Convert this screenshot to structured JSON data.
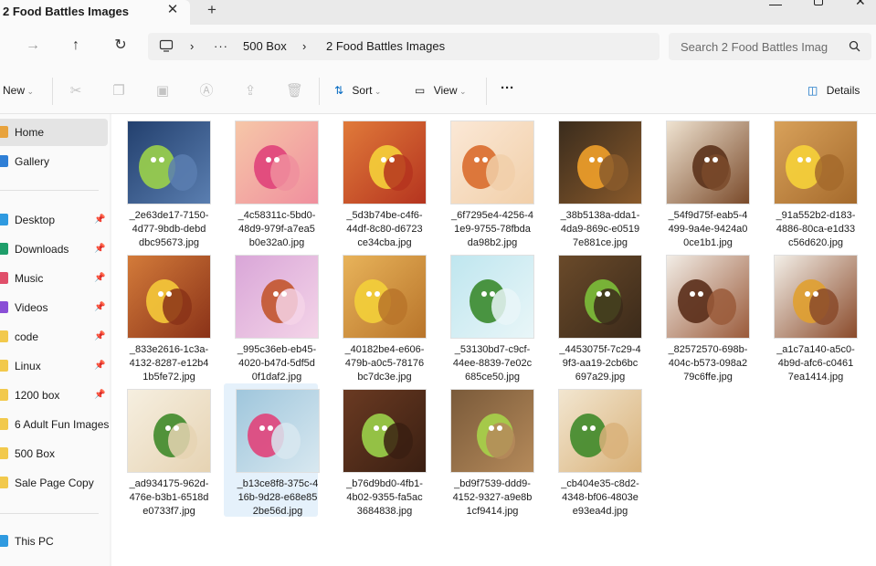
{
  "window": {
    "tab_title": "2 Food Battles Images"
  },
  "address": {
    "segments": [
      "500 Box",
      "2 Food Battles Images"
    ]
  },
  "search": {
    "placeholder": "Search 2 Food Battles Imag"
  },
  "toolbar": {
    "new_label": "New",
    "sort_label": "Sort",
    "view_label": "View",
    "details_label": "Details"
  },
  "sidebar": {
    "items": [
      {
        "label": "Home",
        "icon": "home-icon",
        "color": "#e8a33d"
      },
      {
        "label": "Gallery",
        "icon": "gallery-icon",
        "color": "#2f7fd6"
      },
      {
        "label": "Desktop",
        "icon": "desktop-icon",
        "color": "#2f9ae0"
      },
      {
        "label": "Downloads",
        "icon": "downloads-icon",
        "color": "#1f9e6a"
      },
      {
        "label": "Music",
        "icon": "music-icon",
        "color": "#e04f6a"
      },
      {
        "label": "Videos",
        "icon": "videos-icon",
        "color": "#8a4fd6"
      },
      {
        "label": "code",
        "icon": "folder-icon",
        "color": "#f2c94c"
      },
      {
        "label": "Linux",
        "icon": "folder-icon",
        "color": "#f2c94c"
      },
      {
        "label": "1200 box",
        "icon": "folder-icon",
        "color": "#f2c94c"
      },
      {
        "label": "6 Adult Fun Images",
        "icon": "folder-icon",
        "color": "#f2c94c"
      },
      {
        "label": "500 Box",
        "icon": "folder-icon",
        "color": "#f2c94c"
      },
      {
        "label": "Sale Page Copy",
        "icon": "folder-icon",
        "color": "#f2c94c"
      },
      {
        "label": "This PC",
        "icon": "pc-icon",
        "color": "#2f9ae0"
      }
    ]
  },
  "files": [
    {
      "name": "_2e63de17-7150-4d77-9bdb-debddbc95673.jpg",
      "l1": "_2e63de17-7150-",
      "l2": "4d77-9bdb-debd",
      "l3": "dbc95673.jpg",
      "bg1": "#23406e",
      "bg2": "#5a7eb0",
      "accent": "#9bd24a"
    },
    {
      "name": "_4c58311c-5bd0-48d9-979f-a7ea5b0e32a0.jpg",
      "l1": "_4c58311c-5bd0-",
      "l2": "48d9-979f-a7ea5",
      "l3": "b0e32a0.jpg",
      "bg1": "#f6c7a8",
      "bg2": "#f08f9e",
      "accent": "#e0437a"
    },
    {
      "name": "_5d3b74be-c4f6-44df-8c80-d6723ce34cba.jpg",
      "l1": "_5d3b74be-c4f6-",
      "l2": "44df-8c80-d6723",
      "l3": "ce34cba.jpg",
      "bg1": "#e07a3a",
      "bg2": "#b5341f",
      "accent": "#f5d03a"
    },
    {
      "name": "_6f7295e4-4256-41e9-9755-78fbdada98b2.jpg",
      "l1": "_6f7295e4-4256-4",
      "l2": "1e9-9755-78fbda",
      "l3": "da98b2.jpg",
      "bg1": "#fbe8d6",
      "bg2": "#f1cfa9",
      "accent": "#d96c2c"
    },
    {
      "name": "_38b5138a-dda1-4da9-869c-e05197e881ce.jpg",
      "l1": "_38b5138a-dda1-",
      "l2": "4da9-869c-e0519",
      "l3": "7e881ce.jpg",
      "bg1": "#3a2c1d",
      "bg2": "#8a5a2b",
      "accent": "#f0a02a"
    },
    {
      "name": "_54f9d75f-eab5-4499-9a4e-9424a00ce1b1.jpg",
      "l1": "_54f9d75f-eab5-4",
      "l2": "499-9a4e-9424a0",
      "l3": "0ce1b1.jpg",
      "bg1": "#efe3d1",
      "bg2": "#7a4a2a",
      "accent": "#5b321b"
    },
    {
      "name": "_91a552b2-d183-4886-80ca-e1d33c56d620.jpg",
      "l1": "_91a552b2-d183-",
      "l2": "4886-80ca-e1d33",
      "l3": "c56d620.jpg",
      "bg1": "#d8a15a",
      "bg2": "#a56a2c",
      "accent": "#f6d23a"
    },
    {
      "name": "_833e2616-1c3a-4132-8287-e12b41b5fe72.jpg",
      "l1": "_833e2616-1c3a-",
      "l2": "4132-8287-e12b4",
      "l3": "1b5fe72.jpg",
      "bg1": "#d37b3a",
      "bg2": "#8a3218",
      "accent": "#f5c93a"
    },
    {
      "name": "_995c36eb-eb45-4020-b47d-5df5d0f1daf2.jpg",
      "l1": "_995c36eb-eb45-",
      "l2": "4020-b47d-5df5d",
      "l3": "0f1daf2.jpg",
      "bg1": "#d9a6d8",
      "bg2": "#f4d4e8",
      "accent": "#c2552d"
    },
    {
      "name": "_40182be4-e606-479b-a0c5-78176bc7dc3e.jpg",
      "l1": "_40182be4-e606-",
      "l2": "479b-a0c5-78176",
      "l3": "bc7dc3e.jpg",
      "bg1": "#e8b35a",
      "bg2": "#b8742a",
      "accent": "#f3cf3a"
    },
    {
      "name": "_53130bd7-c9cf-44ee-8839-7e02c685ce50.jpg",
      "l1": "_53130bd7-c9cf-",
      "l2": "44ee-8839-7e02c",
      "l3": "685ce50.jpg",
      "bg1": "#bfe6ef",
      "bg2": "#e9f6f8",
      "accent": "#3a8a2e"
    },
    {
      "name": "_4453075f-7c29-49f3-aa19-2cb6bc697a29.jpg",
      "l1": "_4453075f-7c29-4",
      "l2": "9f3-aa19-2cb6bc",
      "l3": "697a29.jpg",
      "bg1": "#6a4a2a",
      "bg2": "#3b2a1a",
      "accent": "#7cbf3a"
    },
    {
      "name": "_82572570-698b-404c-b573-098a279c6ffe.jpg",
      "l1": "_82572570-698b-",
      "l2": "404c-b573-098a2",
      "l3": "79c6ffe.jpg",
      "bg1": "#f2ede6",
      "bg2": "#9a5a3a",
      "accent": "#5a2e1a"
    },
    {
      "name": "_a1c7a140-a5c0-4b9d-afc6-c04617ea1414.jpg",
      "l1": "_a1c7a140-a5c0-",
      "l2": "4b9d-afc6-c0461",
      "l3": "7ea1414.jpg",
      "bg1": "#f3efe8",
      "bg2": "#8a4a2a",
      "accent": "#e0a030"
    },
    {
      "name": "_ad934175-962d-476e-b3b1-6518de0733f7.jpg",
      "l1": "_ad934175-962d-",
      "l2": "476e-b3b1-6518d",
      "l3": "e0733f7.jpg",
      "bg1": "#f6efe0",
      "bg2": "#e6d3b3",
      "accent": "#3f8a2a"
    },
    {
      "name": "_b13ce8f8-375c-416b-9d28-e68e852be56d.jpg",
      "l1": "_b13ce8f8-375c-4",
      "l2": "16b-9d28-e68e85",
      "l3": "2be56d.jpg",
      "bg1": "#9fc6dc",
      "bg2": "#d8e8f0",
      "accent": "#e0437a"
    },
    {
      "name": "_b76d9bd0-4fb1-4b02-9355-fa5ac3684838.jpg",
      "l1": "_b76d9bd0-4fb1-",
      "l2": "4b02-9355-fa5ac",
      "l3": "3684838.jpg",
      "bg1": "#6a3a22",
      "bg2": "#3a1f12",
      "accent": "#9bd24a"
    },
    {
      "name": "_bd9f7539-ddd9-4152-9327-a9e8b1cf9414.jpg",
      "l1": "_bd9f7539-ddd9-",
      "l2": "4152-9327-a9e8b",
      "l3": "1cf9414.jpg",
      "bg1": "#7a5a3a",
      "bg2": "#b58a5a",
      "accent": "#a7d34a"
    },
    {
      "name": "_cb404e35-c8d2-4348-bf06-4803ee93ea4d.jpg",
      "l1": "_cb404e35-c8d2-",
      "l2": "4348-bf06-4803e",
      "l3": "e93ea4d.jpg",
      "bg1": "#f2e6d0",
      "bg2": "#d9b27a",
      "accent": "#3f8a2a"
    }
  ],
  "colors": {
    "accent": "#0067c0",
    "selection": "#e5f1fb"
  }
}
